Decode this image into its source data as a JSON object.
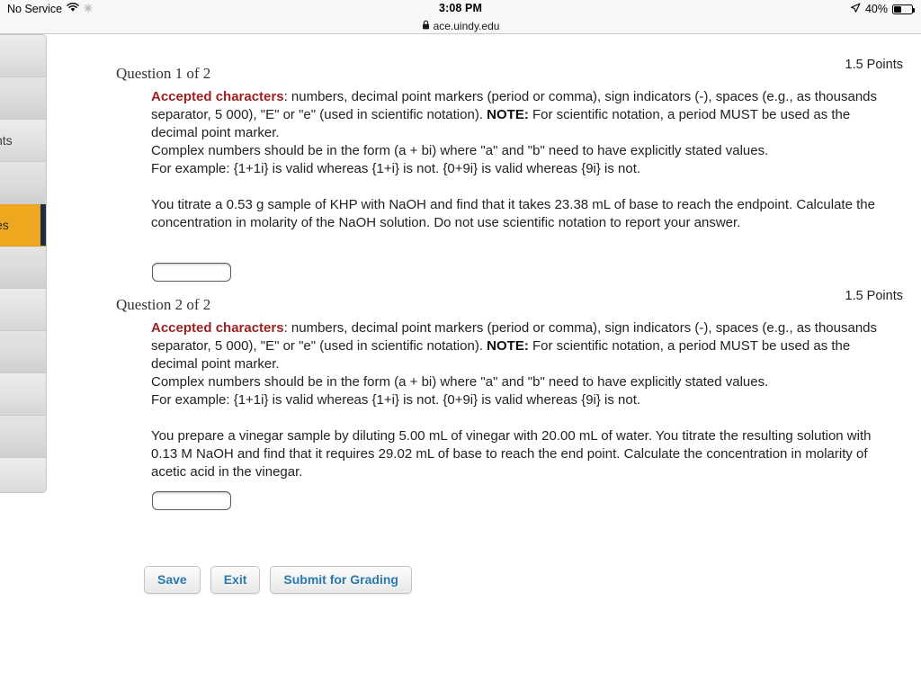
{
  "status_bar": {
    "carrier": "No Service",
    "wifi_icon": "wifi-icon",
    "sync_icon": "sync-icon",
    "time": "3:08 PM",
    "location_icon": "location-arrow-icon",
    "battery_percent": "40%",
    "battery_icon": "battery-icon"
  },
  "url_bar": {
    "lock_icon": "lock-icon",
    "url": "ace.uindy.edu"
  },
  "sidebar": {
    "items": [
      {
        "label": "",
        "active": false
      },
      {
        "label": "",
        "active": false
      },
      {
        "label": "nts",
        "active": false
      },
      {
        "label": "",
        "active": false
      },
      {
        "label": "es",
        "active": true
      },
      {
        "label": "",
        "active": false
      },
      {
        "label": "",
        "active": false
      },
      {
        "label": "",
        "active": false
      },
      {
        "label": "",
        "active": false
      },
      {
        "label": "",
        "active": false
      },
      {
        "label": "",
        "active": false
      }
    ]
  },
  "questions": [
    {
      "title": "Question 1 of 2",
      "points": "1.5 Points",
      "accepted_label": "Accepted characters",
      "accepted_text_1": ": numbers, decimal point markers (period or comma), sign indicators (-), spaces (e.g., as thousands separator, 5 000), \"E\" or \"e\" (used in scientific notation). ",
      "note_label": "NOTE:",
      "accepted_text_2": " For scientific notation, a period MUST be used as the decimal point marker.",
      "complex_line": "Complex numbers should be in the form (a + bi) where \"a\" and \"b\" need to have explicitly stated values.",
      "example_line": "For example: {1+1i} is valid whereas {1+i} is not. {0+9i} is valid whereas {9i} is not.",
      "prompt": "You titrate a 0.53 g sample of KHP with NaOH and find that it takes 23.38 mL of base to reach the endpoint. Calculate the concentration in molarity of the NaOH solution. Do not use scientific notation to report your answer.",
      "answer_value": "",
      "answer_placeholder": ""
    },
    {
      "title": "Question 2 of 2",
      "points": "1.5 Points",
      "accepted_label": "Accepted characters",
      "accepted_text_1": ": numbers, decimal point markers (period or comma), sign indicators (-), spaces (e.g., as thousands separator, 5 000), \"E\" or \"e\" (used in scientific notation). ",
      "note_label": "NOTE:",
      "accepted_text_2": " For scientific notation, a period MUST be used as the decimal point marker.",
      "complex_line": "Complex numbers should be in the form (a + bi) where \"a\" and \"b\" need to have explicitly stated values.",
      "example_line": "For example: {1+1i} is valid whereas {1+i} is not. {0+9i} is valid whereas {9i} is not.",
      "prompt": "You prepare a vinegar sample by diluting 5.00 mL of vinegar with 20.00 mL of water. You titrate the resulting solution with 0.13 M NaOH and find that it requires 29.02 mL of base to reach the end point. Calculate the concentration in molarity of acetic acid in the vinegar.",
      "answer_value": "",
      "answer_placeholder": ""
    }
  ],
  "buttons": {
    "save": "Save",
    "exit": "Exit",
    "submit": "Submit for Grading"
  },
  "colors": {
    "accepted_red": "#9d1f1f",
    "button_blue": "#2a7ab0",
    "sidebar_active": "#eda81f",
    "sidebar_active_border": "#1e2d45"
  }
}
